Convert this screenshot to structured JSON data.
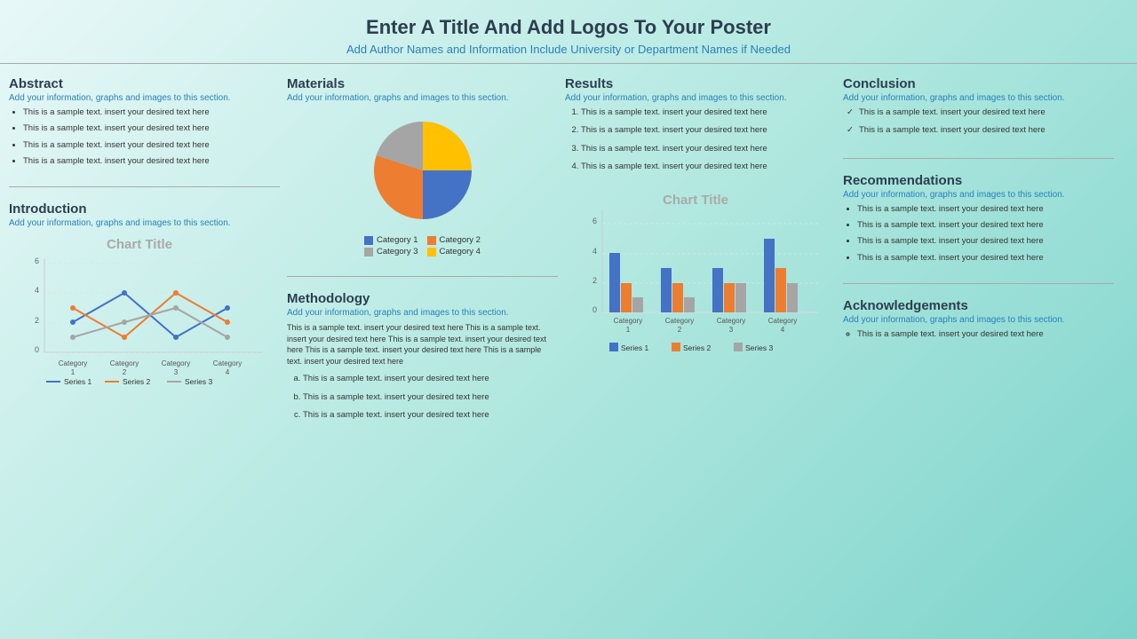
{
  "header": {
    "title": "Enter A Title And Add Logos To Your Poster",
    "subtitle": "Add Author Names and Information Include University or Department Names if Needed"
  },
  "sections": {
    "abstract": {
      "title": "Abstract",
      "subtitle": "Add your information, graphs and images to this section.",
      "items": [
        "This is a sample text. insert your desired text here",
        "This is a sample text. insert your desired text here",
        "This is a sample text. insert your desired text here",
        "This is a sample text. insert your desired text here"
      ]
    },
    "introduction": {
      "title": "Introduction",
      "subtitle": "Add your information, graphs and images to this section.",
      "chart_title": "Chart Title",
      "chart": {
        "categories": [
          "Category 1",
          "Category 2",
          "Category 3",
          "Category 4"
        ],
        "series": [
          {
            "name": "Series 1",
            "color": "#4472c4",
            "values": [
              2,
              4,
              1,
              3
            ]
          },
          {
            "name": "Series 2",
            "color": "#ed7d31",
            "values": [
              3,
              1,
              4,
              2
            ]
          },
          {
            "name": "Series 3",
            "color": "#a5a5a5",
            "values": [
              1,
              2,
              3,
              1
            ]
          }
        ],
        "y_max": 6,
        "y_ticks": [
          0,
          2,
          4,
          6
        ]
      }
    },
    "materials": {
      "title": "Materials",
      "subtitle": "Add your information, graphs and images to this section.",
      "pie": {
        "slices": [
          {
            "label": "Category 1",
            "color": "#4472c4",
            "percent": 25
          },
          {
            "label": "Category 2",
            "color": "#ed7d31",
            "percent": 30
          },
          {
            "label": "Category 3",
            "color": "#a5a5a5",
            "percent": 20
          },
          {
            "label": "Category 4",
            "color": "#ffc000",
            "percent": 25
          }
        ]
      }
    },
    "methodology": {
      "title": "Methodology",
      "subtitle": "Add your information, graphs and images to this section.",
      "body_text": "This is a sample text. insert your desired text here This is a sample text. insert your desired text here This is a sample text. insert your desired text here This is a sample text. insert your desired text here This is a sample text. insert your desired text here",
      "items": [
        "This is a sample text. insert your desired text here",
        "This is a sample text. insert your desired text here",
        "This is a sample text. insert your desired text here"
      ]
    },
    "results": {
      "title": "Results",
      "subtitle": "Add your information, graphs and images to this section.",
      "items": [
        "This is a sample text. insert your desired text here",
        "This is a sample text. insert your desired text here",
        "This is a sample text. insert your desired text here",
        "This is a sample text. insert your desired text here"
      ],
      "chart_title": "Chart Title",
      "chart": {
        "categories": [
          "Category 1",
          "Category 2",
          "Category 3",
          "Category 4"
        ],
        "series": [
          {
            "name": "Series 1",
            "color": "#4472c4",
            "values": [
              4,
              3,
              3,
              5
            ]
          },
          {
            "name": "Series 2",
            "color": "#ed7d31",
            "values": [
              2,
              2,
              2,
              3
            ]
          },
          {
            "name": "Series 3",
            "color": "#a5a5a5",
            "values": [
              1,
              1,
              2,
              2
            ]
          }
        ],
        "y_max": 6,
        "y_ticks": [
          0,
          2,
          4,
          6
        ]
      }
    },
    "conclusion": {
      "title": "Conclusion",
      "subtitle": "Add your information, graphs and images to this section.",
      "items": [
        "This is a sample text. insert your desired text here",
        "This is a sample text. insert your desired text here"
      ]
    },
    "recommendations": {
      "title": "Recommendations",
      "subtitle": "Add your information, graphs and images to this section.",
      "items": [
        "This is a sample text. insert your desired text here",
        "This is a sample text. insert your desired text here",
        "This is a sample text. insert your desired text here",
        "This is a sample text. insert your desired text here"
      ]
    },
    "acknowledgements": {
      "title": "Acknowledgements",
      "subtitle": "Add your information, graphs and images to this section.",
      "items": [
        "This is a sample text. insert your desired text here"
      ]
    }
  }
}
